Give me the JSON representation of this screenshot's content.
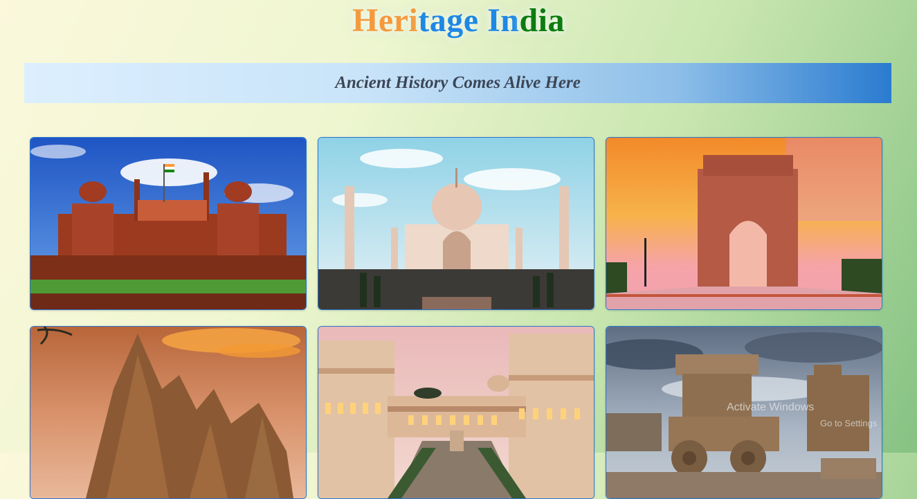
{
  "header": {
    "title_parts": [
      "Heri",
      "tage ",
      "In",
      "dia"
    ],
    "banner_text": "Ancient History Comes Alive Here"
  },
  "colors": {
    "saffron": "#f59a3c",
    "blue": "#1e88e5",
    "green": "#0b7d10",
    "card_border": "#2a74d0"
  },
  "gallery": {
    "cards": [
      {
        "image": "red-fort-photo"
      },
      {
        "image": "taj-mahal-photo"
      },
      {
        "image": "india-gate-photo"
      },
      {
        "image": "khajuraho-temple-photo"
      },
      {
        "image": "palace-courtyard-photo"
      },
      {
        "image": "hampi-stone-chariot-photo"
      }
    ]
  },
  "overlay": {
    "watermark_line1": "Activate Windows",
    "watermark_line2": "Go to Settings"
  }
}
